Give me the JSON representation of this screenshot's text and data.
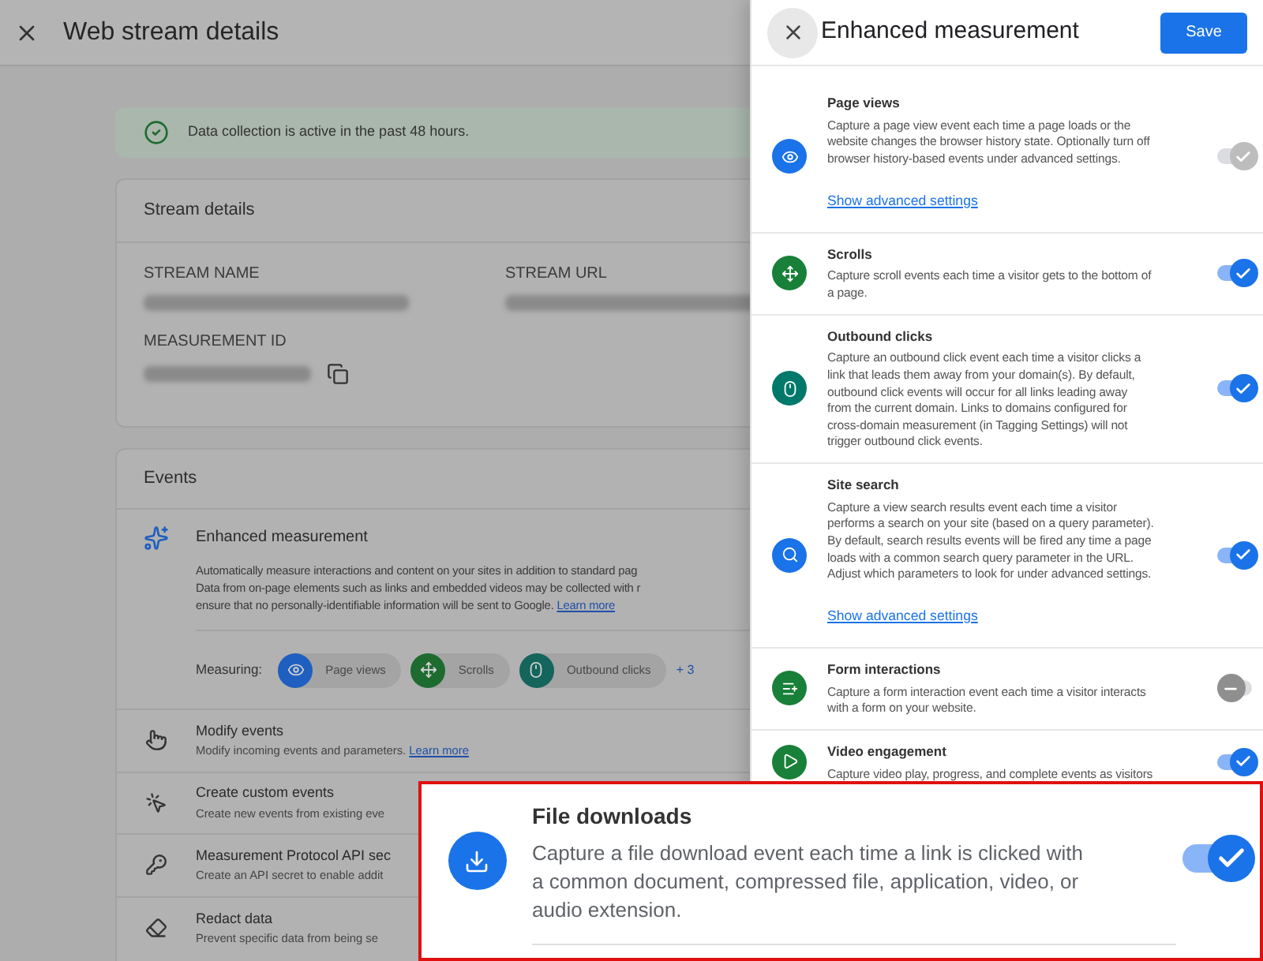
{
  "page": {
    "title": "Web stream details",
    "banner": "Data collection is active in the past 48 hours.",
    "stream_card": {
      "title": "Stream details",
      "fields": [
        {
          "label": "STREAM NAME"
        },
        {
          "label": "STREAM URL"
        },
        {
          "label": "MEASUREMENT ID"
        }
      ]
    },
    "events_card": {
      "title": "Events",
      "enhanced": {
        "title": "Enhanced measurement",
        "lines": [
          "Automatically measure interactions and content on your sites in addition to standard pag",
          "Data from on-page elements such as links and embedded videos may be collected with r",
          "ensure that no personally-identifiable information will be sent to Google."
        ],
        "link": "Learn more",
        "measuring_label": "Measuring:",
        "chips": [
          {
            "label": "Page views",
            "color": "#1f5fbf"
          },
          {
            "label": "Scrolls",
            "color": "#1e6b2f"
          },
          {
            "label": "Outbound clicks",
            "color": "#14655c"
          }
        ],
        "more": "+ 3"
      },
      "rows": [
        {
          "title": "Modify events",
          "desc": "Modify incoming events and parameters.",
          "link": "Learn more"
        },
        {
          "title": "Create custom events",
          "desc": "Create new events from existing eve"
        },
        {
          "title": "Measurement Protocol API sec",
          "desc": "Create an API secret to enable addit"
        },
        {
          "title": "Redact data",
          "desc": "Prevent specific data from being se"
        }
      ]
    }
  },
  "drawer": {
    "title": "Enhanced measurement",
    "save": "Save",
    "items": [
      {
        "title": "Page views",
        "lines": [
          "Capture a page view event each time a page loads or the",
          "website changes the browser history state. Optionally turn off",
          "browser history-based events under advanced settings."
        ],
        "link": "Show advanced settings",
        "color": "#1a73e8",
        "on": true,
        "disabled": true
      },
      {
        "title": "Scrolls",
        "lines": [
          "Capture scroll events each time a visitor gets to the bottom of",
          "a page."
        ],
        "color": "#188038",
        "on": true,
        "disabled": false
      },
      {
        "title": "Outbound clicks",
        "lines": [
          "Capture an outbound click event each time a visitor clicks a",
          "link that leads them away from your domain(s). By default,",
          "outbound click events will occur for all links leading away",
          "from the current domain. Links to domains configured for",
          "cross-domain measurement (in Tagging Settings) will not",
          "trigger outbound click events."
        ],
        "color": "#00796b",
        "on": true,
        "disabled": false
      },
      {
        "title": "Site search",
        "lines": [
          "Capture a view search results event each time a visitor",
          "performs a search on your site (based on a query parameter).",
          "By default, search results events will be fired any time a page",
          "loads with a common search query parameter in the URL.",
          "Adjust which parameters to look for under advanced settings."
        ],
        "link": "Show advanced settings",
        "color": "#1a73e8",
        "on": true,
        "disabled": false
      },
      {
        "title": "Form interactions",
        "lines": [
          "Capture a form interaction event each time a visitor interacts",
          "with a form on your website."
        ],
        "color": "#188038",
        "on": false,
        "disabled": false
      },
      {
        "title": "Video engagement",
        "lines": [
          "Capture video play, progress, and complete events as visitors"
        ],
        "color": "#188038",
        "on": true,
        "disabled": false
      }
    ]
  },
  "callout": {
    "title": "File downloads",
    "lines": [
      "Capture a file download event each time a link is clicked with",
      "a common document, compressed file, application, video, or",
      "audio extension."
    ],
    "color": "#1a73e8",
    "on": true
  }
}
